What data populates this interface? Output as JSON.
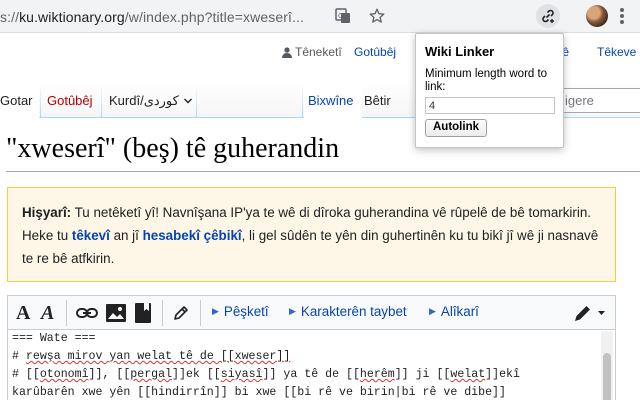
{
  "browser": {
    "url_scheme": "s://",
    "url_host": "ku.wiktionary.org",
    "url_path": "/w/index.php?title=xweserî..."
  },
  "personal_bar": {
    "user": "Têneketî",
    "talk": "Gotûbêj",
    "contributions": "Tê",
    "login": "Têkeve"
  },
  "tabs": {
    "page": "Gotar",
    "talk": "Gotûbêj",
    "language": "Kurdî/كوردی",
    "read": "Bixwîne",
    "more": "Bêtir",
    "search_placeholder": "igere"
  },
  "page": {
    "title": "\"xweserî\" (beş) tê guherandin"
  },
  "warning": {
    "label": "Hişyarî:",
    "text1": " Tu netêketî yî! Navnîşana IP'ya te wê di dîroka guherandina vê rûpelê de bê tomarkirin. Heke tu ",
    "link1": "têkevî",
    "text2": " an jî ",
    "link2": "hesabekî çêbikî",
    "text3": ", li gel sûdên te yên din guhertinên ku tu bikî jî wê ji nasnavê te re bê atfkirin."
  },
  "toolbar": {
    "bold": "A",
    "italic": "A",
    "advanced": "Pêşketî",
    "special_chars": "Karakterên taybet",
    "help": "Alîkarî"
  },
  "editor": {
    "line1": "=== Wate ===",
    "line2_a": "# ",
    "line2_b": "rewşa mirov yan welat tê de [[xweser]]",
    "line3_a": "# [[",
    "line3_b": "otonomî",
    "line3_c": "]], [[",
    "line3_d": "pergal",
    "line3_e": "]]ek [[",
    "line3_f": "siyasî",
    "line3_g": "]] ya tê de [[",
    "line3_h": "herêm",
    "line3_i": "]] ji [[",
    "line3_j": "welat",
    "line3_k": "]]ekî",
    "line4": "karûbarên xwe yên [[hindirrîn]] bi xwe [[bi rê ve birin|bi rê ve dibe]]"
  },
  "popup": {
    "title": "Wiki Linker",
    "label": "Minimum length word to link:",
    "value": "4",
    "button": "Autolink"
  }
}
